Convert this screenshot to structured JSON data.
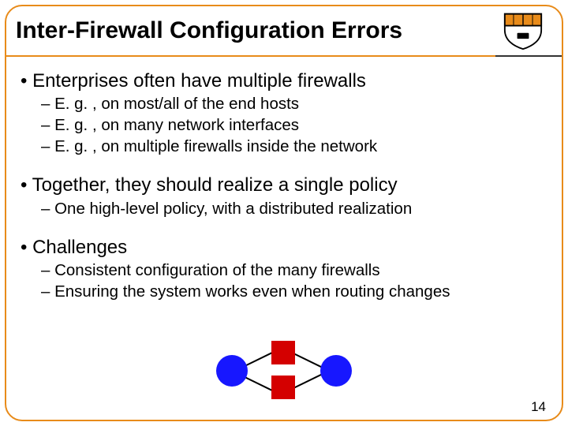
{
  "title": "Inter-Firewall Configuration Errors",
  "bullets": {
    "b1": "• Enterprises often have multiple firewalls",
    "b1s1": "– E. g. , on most/all of the end hosts",
    "b1s2": "– E. g. , on many network interfaces",
    "b1s3": "– E. g. , on multiple firewalls inside the network",
    "b2": "• Together, they should realize a single policy",
    "b2s1": "– One high-level policy, with a distributed realization",
    "b3": "• Challenges",
    "b3s1": "– Consistent configuration of the many firewalls",
    "b3s2": "– Ensuring the system works even when routing changes"
  },
  "page_number": "14"
}
